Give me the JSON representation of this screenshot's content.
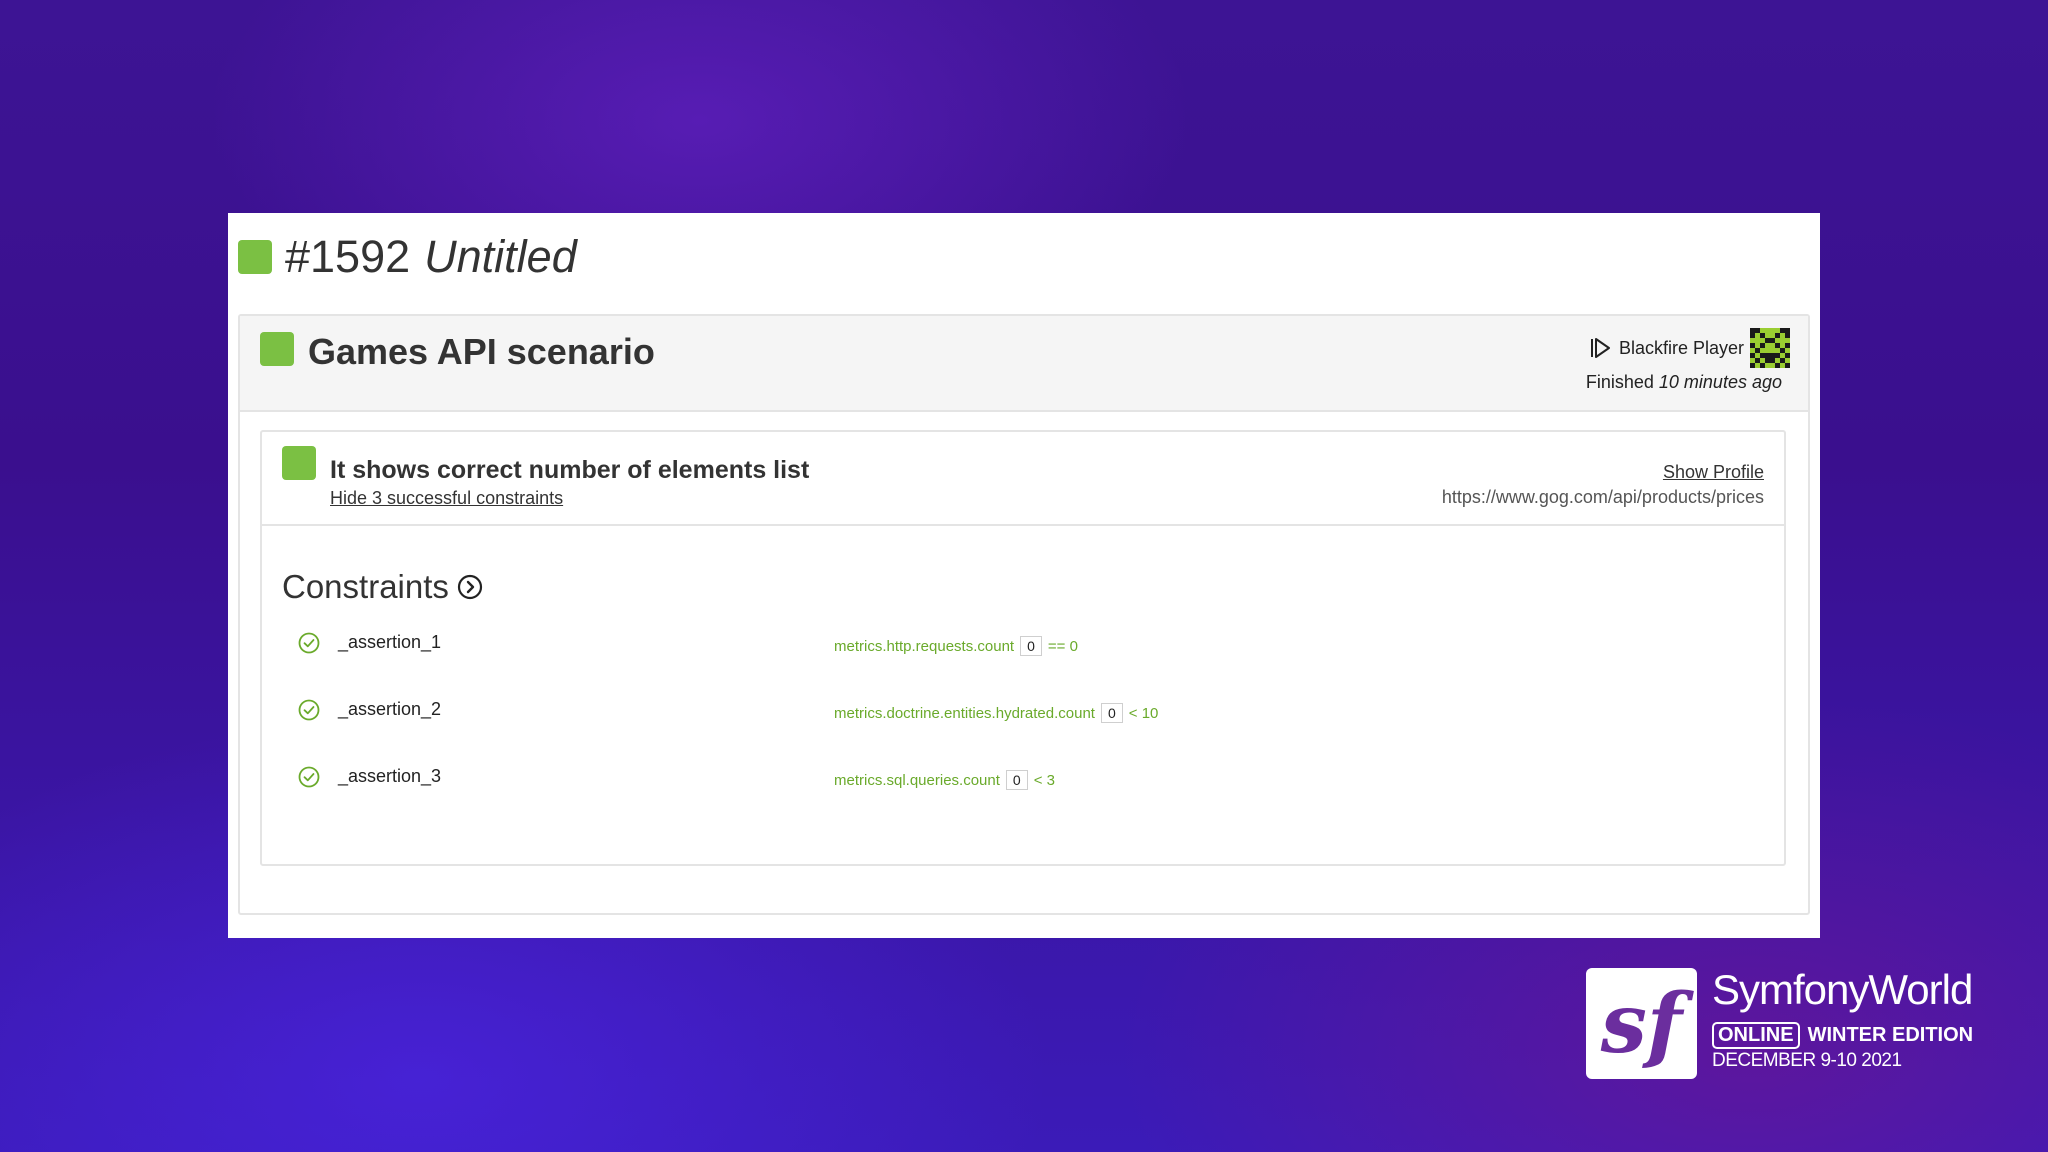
{
  "build": {
    "number": "#1592",
    "name": "Untitled"
  },
  "scenario": {
    "title": "Games API scenario",
    "player_label": "Blackfire Player",
    "finished_label": "Finished",
    "finished_time": "10 minutes ago"
  },
  "test": {
    "title": "It shows correct number of elements list",
    "hide_link": "Hide 3 successful constraints",
    "show_profile": "Show Profile",
    "url": "https://www.gog.com/api/products/prices"
  },
  "constraints": {
    "heading": "Constraints",
    "items": [
      {
        "name": "_assertion_1",
        "metric": "metrics.http.requests.count",
        "value": "0",
        "condition": "== 0"
      },
      {
        "name": "_assertion_2",
        "metric": "metrics.doctrine.entities.hydrated.count",
        "value": "0",
        "condition": "< 10"
      },
      {
        "name": "_assertion_3",
        "metric": "metrics.sql.queries.count",
        "value": "0",
        "condition": "< 3"
      }
    ]
  },
  "branding": {
    "logo_letter": "sf",
    "name": "SymfonyWorld",
    "online": "ONLINE",
    "edition": "WINTER EDITION",
    "dates": "DECEMBER 9-10 2021"
  },
  "colors": {
    "status_green": "#7bc043",
    "metric_green": "#6aaa2b"
  },
  "icons": [
    "play-icon",
    "avatar-icon",
    "chevron-circle-icon",
    "check-circle-icon"
  ]
}
